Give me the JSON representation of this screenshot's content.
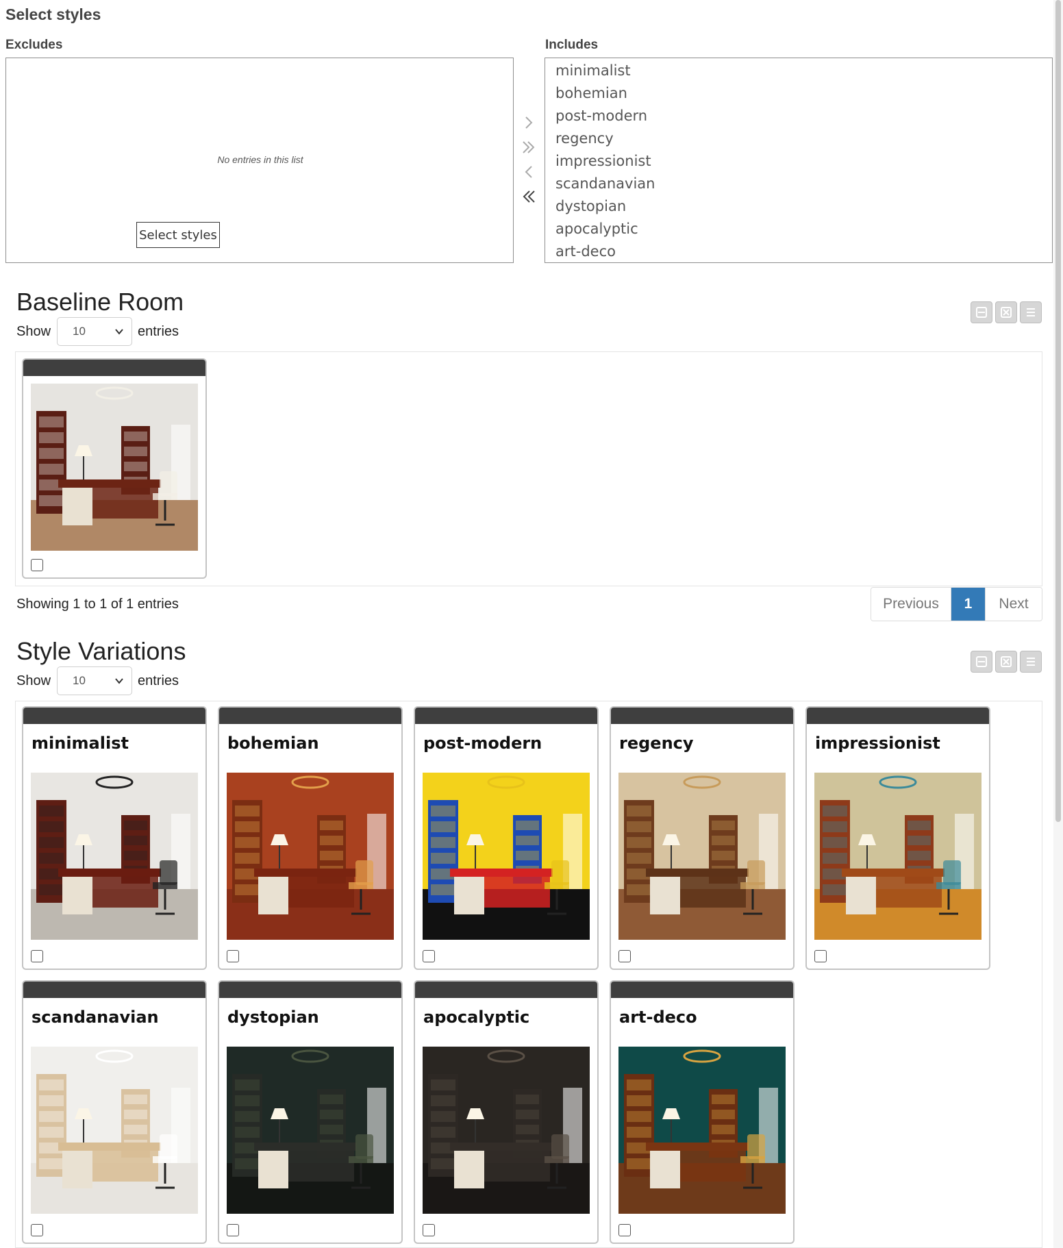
{
  "dual_list": {
    "title": "Select styles",
    "excludes_label": "Excludes",
    "includes_label": "Includes",
    "empty_message": "No entries in this list",
    "select_button": "Select styles",
    "includes": [
      "minimalist",
      "bohemian",
      "post-modern",
      "regency",
      "impressionist",
      "scandanavian",
      "dystopian",
      "apocalyptic",
      "art-deco"
    ]
  },
  "baseline": {
    "title": "Baseline Room",
    "show_label": "Show",
    "page_length": "10",
    "entries_label": "entries",
    "info": "Showing 1 to 1 of 1 entries",
    "previous": "Previous",
    "page": "1",
    "next": "Next"
  },
  "variations": {
    "title": "Style Variations",
    "show_label": "Show",
    "page_length": "10",
    "entries_label": "entries",
    "cards": [
      {
        "title": "minimalist",
        "wall": "#e8e6e2",
        "floor": "#bdb8b0",
        "shelf": "#5e1e14",
        "desk": "#6a1c10",
        "accent": "#222222"
      },
      {
        "title": "bohemian",
        "wall": "#a9411f",
        "floor": "#8a2f18",
        "shelf": "#7b2d12",
        "desk": "#7a2410",
        "accent": "#e3a04b"
      },
      {
        "title": "post-modern",
        "wall": "#f3d21b",
        "floor": "#111111",
        "shelf": "#1e4bb3",
        "desk": "#d42222",
        "accent": "#e7c21a"
      },
      {
        "title": "regency",
        "wall": "#d7c3a0",
        "floor": "#8f5a36",
        "shelf": "#6e3b1d",
        "desk": "#5d3218",
        "accent": "#c79b5a"
      },
      {
        "title": "impressionist",
        "wall": "#cfc39a",
        "floor": "#d08a2a",
        "shelf": "#8e3a1a",
        "desk": "#a04a18",
        "accent": "#3a8a9a"
      },
      {
        "title": "scandanavian",
        "wall": "#f0efec",
        "floor": "#e7e4df",
        "shelf": "#d9c2a0",
        "desk": "#d8bd94",
        "accent": "#ffffff"
      },
      {
        "title": "dystopian",
        "wall": "#1f2a26",
        "floor": "#141714",
        "shelf": "#262a26",
        "desk": "#2b2d29",
        "accent": "#4a5540"
      },
      {
        "title": "apocalyptic",
        "wall": "#2a2622",
        "floor": "#1a1715",
        "shelf": "#2d2824",
        "desk": "#332d28",
        "accent": "#5a5046"
      },
      {
        "title": "art-deco",
        "wall": "#0f4a48",
        "floor": "#6e3a1a",
        "shelf": "#6a2e12",
        "desk": "#7a3512",
        "accent": "#d9a441"
      }
    ]
  },
  "baseline_room": {
    "wall": "#e6e4e0",
    "floor": "#b08866",
    "shelf": "#5a1e14",
    "desk": "#6c2414",
    "accent": "#f2efe6"
  }
}
